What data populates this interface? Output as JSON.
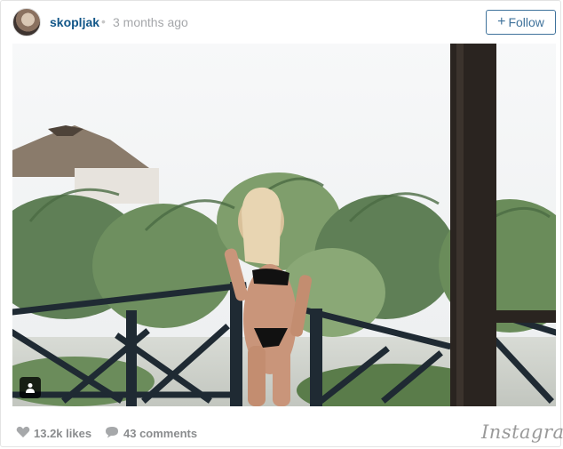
{
  "header": {
    "username": "skopljak",
    "separator": "•",
    "timestamp": "3 months ago",
    "follow_label": "Follow",
    "follow_icon": "plus-icon"
  },
  "post": {
    "image_subject": "woman-on-balcony-with-palm-trees"
  },
  "footer": {
    "likes": "13.2k likes",
    "comments": "43 comments",
    "brand": "Instagram"
  },
  "colors": {
    "accent": "#3f729b",
    "username": "#125688",
    "muted": "#a5a7aa"
  }
}
